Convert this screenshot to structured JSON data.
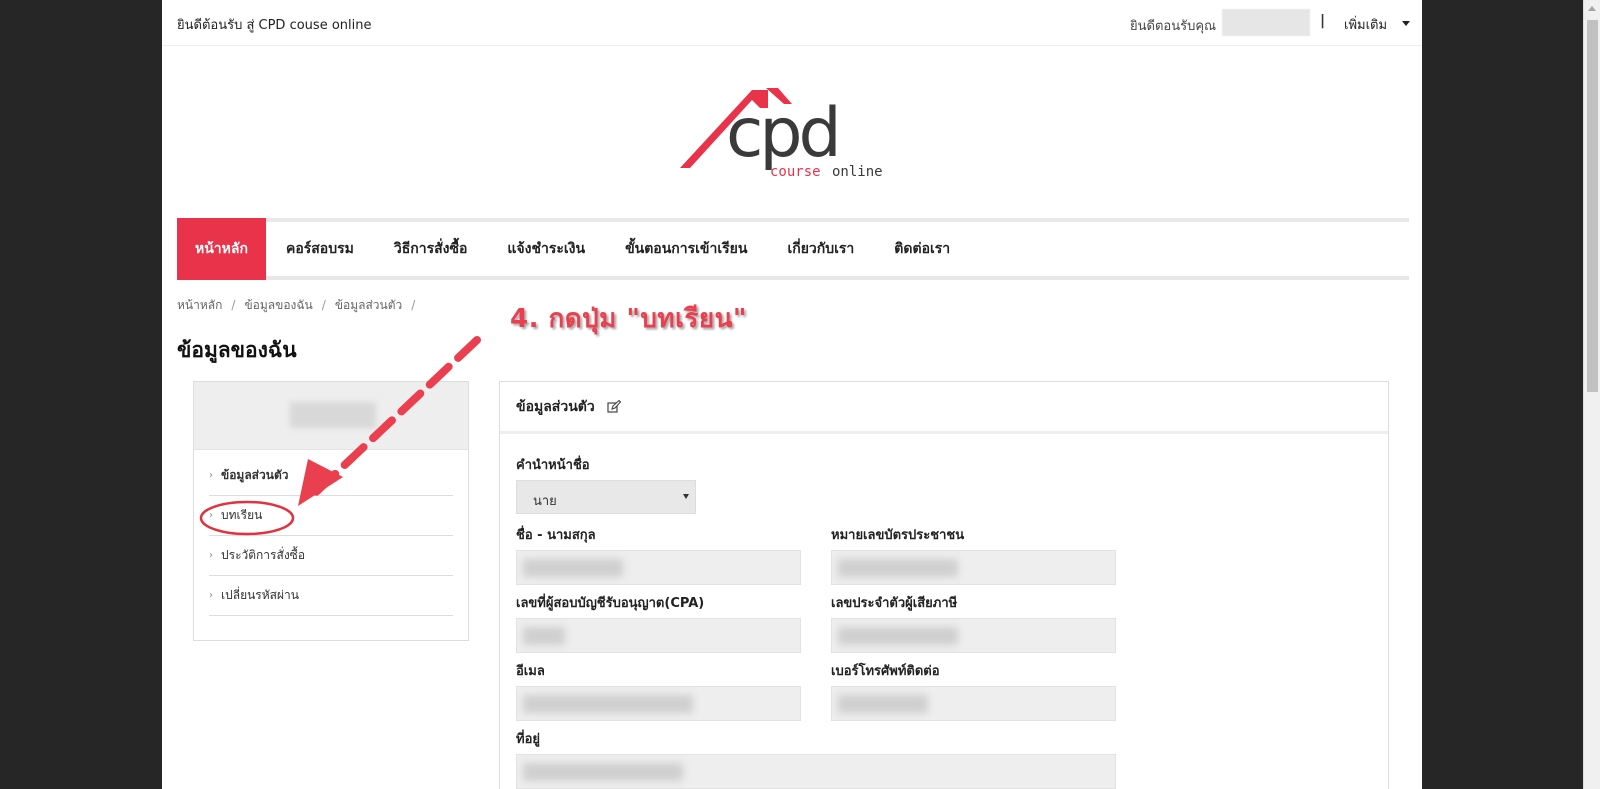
{
  "topbar": {
    "welcome": "ยินดีต้อนรับ สู่ CPD couse online",
    "greeting": "ยินดีตอนรับคุณ",
    "separator": "|",
    "more": "เพิ่มเติม"
  },
  "logo": {
    "mark": "cpd",
    "word1": "course",
    "word2": "online",
    "brand_color": "#e8334a"
  },
  "nav": {
    "items": [
      {
        "label": "หน้าหลัก",
        "active": true
      },
      {
        "label": "คอร์สอบรม"
      },
      {
        "label": "วิธีการสั่งซื้อ"
      },
      {
        "label": "แจ้งชำระเงิน"
      },
      {
        "label": "ขั้นตอนการเข้าเรียน"
      },
      {
        "label": "เกี่ยวกับเรา"
      },
      {
        "label": "ติดต่อเรา"
      }
    ]
  },
  "breadcrumb": [
    "หน้าหลัก",
    "ข้อมูลของฉัน",
    "ข้อมูลส่วนตัว",
    "/"
  ],
  "page_title": "ข้อมูลของฉัน",
  "sidebar": {
    "items": [
      {
        "label": "ข้อมูลส่วนตัว"
      },
      {
        "label": "บทเรียน"
      },
      {
        "label": "ประวัติการสั่งซื้อ"
      },
      {
        "label": "เปลี่ยนรหัสผ่าน"
      }
    ],
    "chevron": "›"
  },
  "panel": {
    "title": "ข้อมูลส่วนตัว",
    "fields": {
      "prefix_label": "คำนำหน้าชื่อ",
      "prefix_value": "นาย",
      "name_label": "ชื่อ - นามสกุล",
      "id_label": "หมายเลขบัตรประชาชน",
      "cpa_label": "เลขที่ผู้สอบบัญชีรับอนุญาต(CPA)",
      "tax_label": "เลขประจำตัวผู้เสียภาษี",
      "email_label": "อีเมล",
      "phone_label": "เบอร์โทรศัพท์ติดต่อ",
      "address_label": "ที่อยู่"
    }
  },
  "annotation": {
    "text": "4. กดปุ่ม \"บทเรียน\"",
    "color": "#ea3f4f"
  }
}
